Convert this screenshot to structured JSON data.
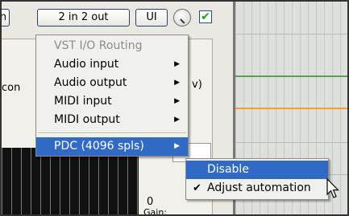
{
  "toolbar": {
    "left_partial_label": "n",
    "io_button_label": "2 in 2 out",
    "ui_button_label": "UI",
    "checkbox_checked": "✔"
  },
  "background": {
    "partial_text_left": "con",
    "partial_text_right": "v)",
    "zero_label": "0",
    "gain_label": "Gain:"
  },
  "menu": {
    "items": [
      {
        "label": "VST I/O Routing",
        "disabled": true
      },
      {
        "label": "Audio input",
        "submenu": true
      },
      {
        "label": "Audio output",
        "submenu": true
      },
      {
        "label": "MIDI input",
        "submenu": true
      },
      {
        "label": "MIDI output",
        "submenu": true
      },
      {
        "label": "PDC (4096 spls)",
        "submenu": true,
        "highlighted": true
      }
    ],
    "arrow_glyph": "▶"
  },
  "submenu": {
    "items": [
      {
        "label": "Disable",
        "highlighted": true
      },
      {
        "label": "Adjust automation",
        "checked": true
      }
    ],
    "check_glyph": "✔"
  },
  "colors": {
    "highlight": "#316ac5",
    "grid_green": "#5aa05a",
    "grid_orange": "#f0a030"
  }
}
